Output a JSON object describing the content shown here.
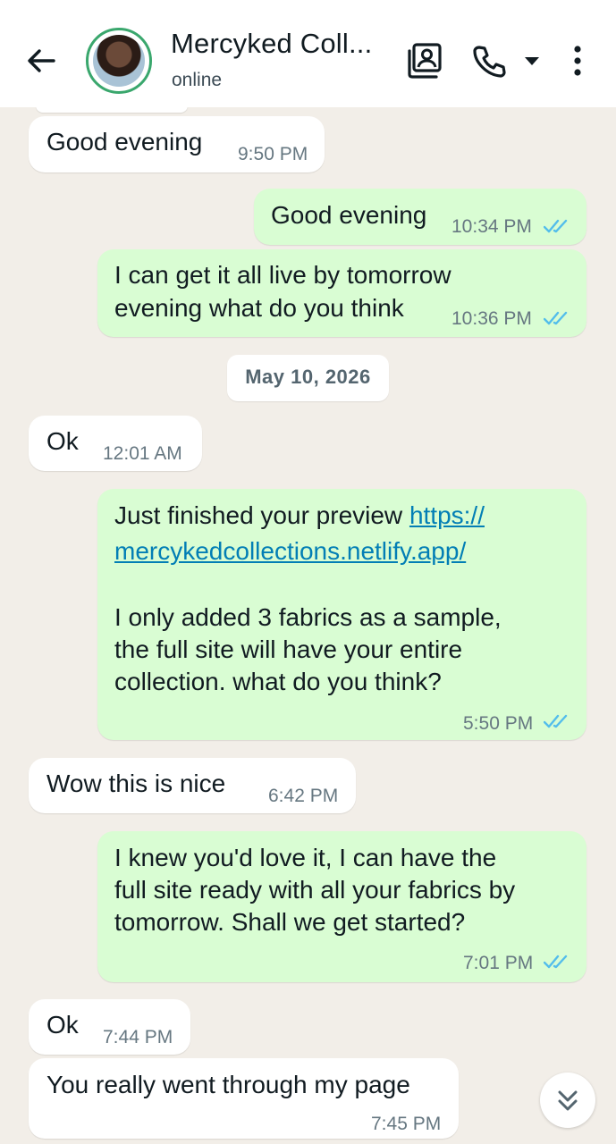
{
  "header": {
    "back_icon": "arrow-left-icon",
    "contact_name": "Mercyked Coll...",
    "status": "online",
    "icons": [
      "contact-card-icon",
      "phone-icon",
      "caret-down-icon",
      "more-vert-icon"
    ]
  },
  "messages": [
    {
      "dir": "in",
      "text": "Good evening",
      "time": "9:50 PM"
    },
    {
      "dir": "out",
      "text": "Good evening",
      "time": "10:34 PM",
      "read": true
    },
    {
      "dir": "out",
      "lines": [
        "I can get it all live by tomorrow",
        "evening what do you think"
      ],
      "time": "10:36 PM",
      "read": true
    },
    {
      "dir": "in",
      "text": "Ok",
      "time": "12:01 AM"
    },
    {
      "dir": "out",
      "prefix": "Just finished your preview ",
      "link_part1": "https://",
      "link_part2": "mercykedcollections.netlify.app/",
      "lines": [
        "I only added 3 fabrics as a sample,",
        "the full site will have your entire",
        "collection. what do you think?"
      ],
      "time": "5:50 PM",
      "read": true
    },
    {
      "dir": "in",
      "text": "Wow this is nice",
      "time": "6:42 PM"
    },
    {
      "dir": "out",
      "lines": [
        "I knew you'd love it, I can have the",
        "full site ready with all your fabrics by",
        "tomorrow. Shall we get started?"
      ],
      "time": "7:01 PM",
      "read": true
    },
    {
      "dir": "in",
      "text": "Ok",
      "time": "7:44 PM"
    },
    {
      "dir": "in",
      "text": "You really went through my page",
      "time": "7:45 PM"
    }
  ],
  "date_separator": "May 10, 2026",
  "colors": {
    "incoming": "#ffffff",
    "outgoing": "#d9fdd3",
    "read_ticks": "#53bdeb",
    "background": "#f2eee8",
    "link": "#027eb5"
  },
  "scroll_button_icon": "double-chevron-down-icon"
}
